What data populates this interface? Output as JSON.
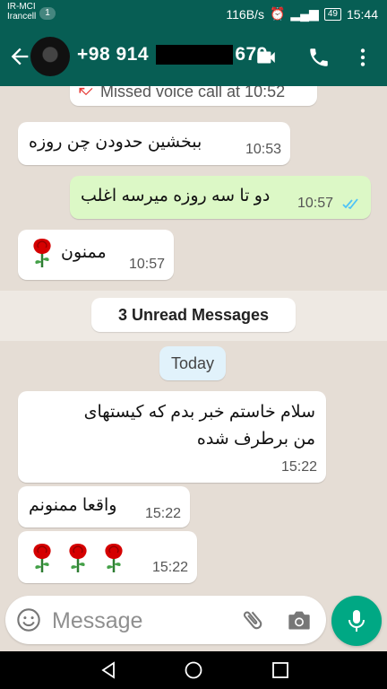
{
  "status_bar": {
    "carrier1": "IR-MCI",
    "carrier2": "Irancell",
    "badge": "1",
    "speed": "116B/s",
    "battery": "49",
    "time": "15:44"
  },
  "header": {
    "phone_prefix": "+98 914",
    "phone_suffix": "679"
  },
  "messages": {
    "missed_call": "Missed voice call at 10:52",
    "m1": {
      "text": "ببخشین حدودن چن روزه",
      "time": "10:53"
    },
    "m2": {
      "text": "دو تا سه روزه میرسه اغلب",
      "time": "10:57"
    },
    "m3": {
      "text": "ممنون",
      "time": "10:57"
    },
    "unread": "3 Unread Messages",
    "today": "Today",
    "m4": {
      "line1": "سلام خاستم خبر بدم که کیستهای",
      "line2": "من برطرف شده",
      "time": "15:22"
    },
    "m5": {
      "text": "واقعا ممنونم",
      "time": "15:22"
    },
    "m6": {
      "time": "15:22"
    }
  },
  "input": {
    "placeholder": "Message"
  },
  "colors": {
    "header": "#075e54",
    "chat_bg": "#e5ddd5",
    "outgoing": "#dcf8c6",
    "mic": "#00a884",
    "read_ticks": "#4fc3f7",
    "missed_call": "#e53935"
  },
  "icons": [
    "back-arrow-icon",
    "video-call-icon",
    "phone-icon",
    "more-vert-icon",
    "missed-call-icon",
    "read-ticks-icon",
    "rose-icon",
    "emoji-icon",
    "attach-icon",
    "camera-icon",
    "mic-icon",
    "nav-back-icon",
    "nav-home-icon",
    "nav-recents-icon"
  ]
}
